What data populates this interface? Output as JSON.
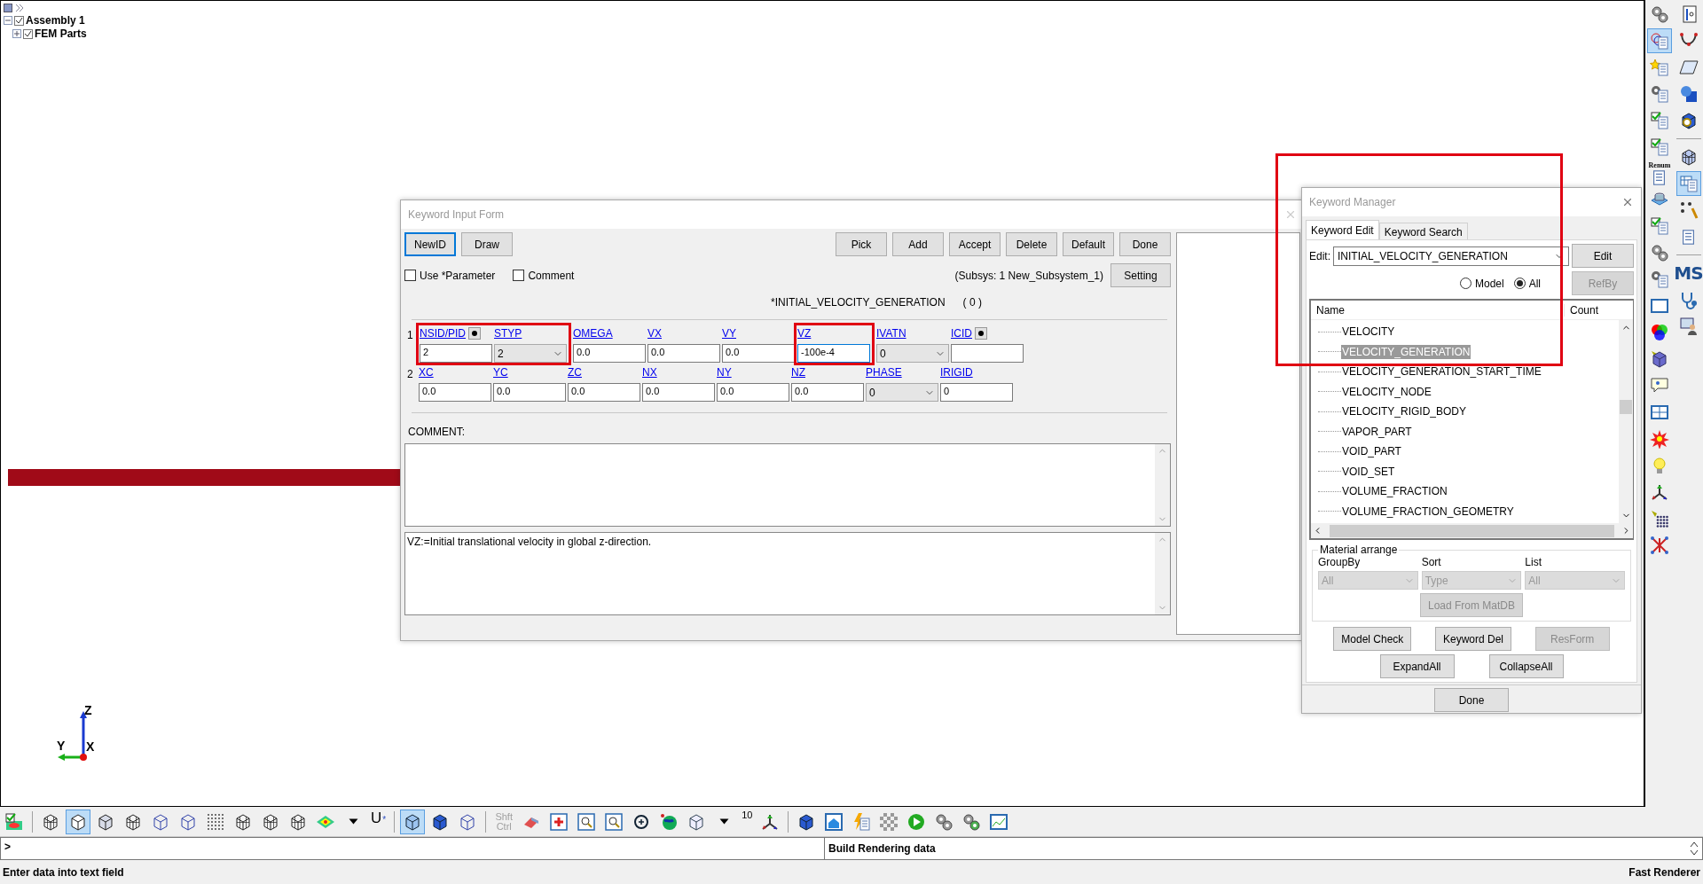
{
  "tree": [
    {
      "label": "Assembly 1",
      "checked": true,
      "expanded": true,
      "children": [
        {
          "label": "FEM Parts",
          "checked": true,
          "expanded": false
        }
      ]
    }
  ],
  "axis": {
    "z": "Z",
    "y": "Y",
    "x": "X"
  },
  "keyword_form": {
    "title": "Keyword Input Form",
    "left_buttons": [
      {
        "label": "NewID",
        "focused": true
      },
      {
        "label": "Draw",
        "focused": false
      }
    ],
    "right_buttons": [
      "Pick",
      "Add",
      "Accept",
      "Delete",
      "Default",
      "Done"
    ],
    "options": [
      {
        "label": "Use *Parameter",
        "checked": false
      },
      {
        "label": "Comment",
        "checked": false
      }
    ],
    "subsys": "(Subsys: 1 New_Subsystem_1)",
    "setting_button": "Setting",
    "keyword": "*INITIAL_VELOCITY_GENERATION",
    "count": "( 0 )",
    "cards": [
      {
        "number": "1",
        "fields": [
          {
            "label": "NSID/PID",
            "kind": "text",
            "value": "2",
            "pick": true,
            "highlighted": true,
            "focused": false
          },
          {
            "label": "STYP",
            "kind": "select",
            "value": "2",
            "highlighted": true,
            "focused": false
          },
          {
            "label": "OMEGA",
            "kind": "text",
            "value": "0.0",
            "focused": false
          },
          {
            "label": "VX",
            "kind": "text",
            "value": "0.0",
            "focused": false
          },
          {
            "label": "VY",
            "kind": "text",
            "value": "0.0",
            "focused": false
          },
          {
            "label": "VZ",
            "kind": "text",
            "value": "-100e-4",
            "highlighted": true,
            "focused": true
          },
          {
            "label": "IVATN",
            "kind": "select",
            "value": "0",
            "focused": false
          },
          {
            "label": "ICID",
            "kind": "text",
            "pick": true,
            "focused": false
          }
        ]
      },
      {
        "number": "2",
        "fields": [
          {
            "label": "XC",
            "kind": "text",
            "value": "0.0",
            "focused": false
          },
          {
            "label": "YC",
            "kind": "text",
            "value": "0.0",
            "focused": false
          },
          {
            "label": "ZC",
            "kind": "text",
            "value": "0.0",
            "focused": false
          },
          {
            "label": "NX",
            "kind": "text",
            "value": "0.0",
            "focused": false
          },
          {
            "label": "NY",
            "kind": "text",
            "value": "0.0",
            "focused": false
          },
          {
            "label": "NZ",
            "kind": "text",
            "value": "0.0",
            "focused": false
          },
          {
            "label": "PHASE",
            "kind": "select",
            "value": "0",
            "focused": false
          },
          {
            "label": "IRIGID",
            "kind": "text",
            "value": "0",
            "focused": false
          }
        ]
      }
    ],
    "comment_label": "COMMENT:",
    "help": "VZ:=Initial translational velocity in global z-direction."
  },
  "keyword_manager": {
    "title": "Keyword Manager",
    "annotation_frame": true,
    "tabs": [
      {
        "label": "Keyword Edit",
        "selected": true
      },
      {
        "label": "Keyword Search",
        "selected": false
      }
    ],
    "edit_label": "Edit:",
    "edit_value": "INITIAL_VELOCITY_GENERATION",
    "edit_button": "Edit",
    "scope": [
      {
        "label": "Model",
        "selected": false
      },
      {
        "label": "All",
        "selected": true
      }
    ],
    "refby_button": {
      "label": "RefBy",
      "disabled": true
    },
    "columns": [
      "Name",
      "Count"
    ],
    "items": [
      {
        "label": "VELOCITY",
        "selected": false
      },
      {
        "label": "VELOCITY_GENERATION",
        "selected": true
      },
      {
        "label": "VELOCITY_GENERATION_START_TIME",
        "selected": false
      },
      {
        "label": "VELOCITY_NODE",
        "selected": false
      },
      {
        "label": "VELOCITY_RIGID_BODY",
        "selected": false
      },
      {
        "label": "VAPOR_PART",
        "selected": false
      },
      {
        "label": "VOID_PART",
        "selected": false
      },
      {
        "label": "VOID_SET",
        "selected": false
      },
      {
        "label": "VOLUME_FRACTION",
        "selected": false
      },
      {
        "label": "VOLUME_FRACTION_GEOMETRY",
        "selected": false
      }
    ],
    "material": {
      "legend": "Material arrange",
      "selects": [
        {
          "label": "GroupBy",
          "value": "All"
        },
        {
          "label": "Sort",
          "value": "Type"
        },
        {
          "label": "List",
          "value": "All"
        }
      ],
      "load_button": "Load From MatDB",
      "disabled": true
    },
    "button_rows": [
      [
        {
          "label": "Model Check",
          "disabled": false
        },
        {
          "label": "Keyword Del",
          "disabled": false
        },
        {
          "label": "ResForm",
          "disabled": true
        }
      ],
      [
        {
          "label": "ExpandAll",
          "disabled": false
        },
        {
          "label": "CollapseAll",
          "disabled": false
        }
      ]
    ],
    "done_button": "Done"
  },
  "right_toolbar": [
    [
      {
        "kind": "gears",
        "selected": false
      },
      {
        "kind": "circles",
        "selected": true
      },
      {
        "kind": "starlist",
        "selected": false
      },
      {
        "kind": "gearlist",
        "selected": false
      },
      {
        "kind": "checklist",
        "selected": false
      },
      {
        "kind": "checklist",
        "selected": false
      },
      {
        "kind": "renum",
        "label": "Renum"
      },
      {
        "kind": "cylinder",
        "selected": false
      },
      {
        "kind": "stacklist",
        "selected": false
      },
      {
        "kind": "gears",
        "selected": false
      },
      {
        "kind": "gearpage",
        "selected": false
      },
      {
        "kind": "window",
        "selected": false
      },
      {
        "kind": "rgb",
        "selected": false
      },
      {
        "kind": "lamp",
        "selected": false
      },
      {
        "kind": "speech",
        "selected": false
      },
      {
        "kind": "grid",
        "selected": false
      },
      {
        "kind": "burst",
        "selected": false
      },
      {
        "kind": "bulb",
        "selected": false
      },
      {
        "kind": "triad",
        "selected": false
      },
      {
        "kind": "lampdots",
        "selected": false
      },
      {
        "kind": "network",
        "selected": false
      }
    ],
    [
      {
        "kind": "axispage",
        "selected": false
      },
      {
        "kind": "curve",
        "selected": false
      },
      {
        "kind": "plane",
        "selected": false
      },
      {
        "kind": "sphere",
        "selected": false
      },
      {
        "kind": "magcube",
        "selected": false
      },
      {
        "kind": "separator"
      },
      {
        "kind": "nodegrid",
        "selected": false
      },
      {
        "kind": "table",
        "selected": true
      },
      {
        "kind": "wrench",
        "selected": false
      },
      {
        "kind": "doclist",
        "selected": false
      },
      {
        "kind": "separator"
      },
      {
        "kind": "label",
        "label": "MS"
      },
      {
        "kind": "stetho",
        "selected": false
      },
      {
        "kind": "person",
        "selected": false
      }
    ]
  ],
  "bottom_toolbar": [
    {
      "kind": "meshcheck",
      "selected": false
    },
    {
      "kind": "separator"
    },
    {
      "kind": "meshcube",
      "selected": false
    },
    {
      "kind": "cube",
      "selected": true
    },
    {
      "kind": "shadecube",
      "selected": false
    },
    {
      "kind": "meshcube",
      "selected": false
    },
    {
      "kind": "wirecube",
      "selected": false
    },
    {
      "kind": "wirecube",
      "selected": false
    },
    {
      "kind": "dotcube",
      "selected": false
    },
    {
      "kind": "meshcube",
      "selected": false
    },
    {
      "kind": "meshcube",
      "selected": false
    },
    {
      "kind": "meshcube",
      "selected": false
    },
    {
      "kind": "colormap",
      "selected": false
    },
    {
      "kind": "caret",
      "selected": false
    },
    {
      "kind": "label",
      "label": "U",
      "sub": "*"
    },
    {
      "kind": "separator"
    },
    {
      "kind": "bluecube",
      "selected": true
    },
    {
      "kind": "solidcube",
      "selected": false
    },
    {
      "kind": "wirecube",
      "selected": false
    },
    {
      "kind": "separator"
    },
    {
      "kind": "label",
      "label": "Shft",
      "sub": "Ctrl",
      "disabled": true
    },
    {
      "kind": "eraser",
      "selected": false
    },
    {
      "kind": "zoomcross",
      "selected": false
    },
    {
      "kind": "zoomin",
      "selected": false
    },
    {
      "kind": "zoomwin",
      "selected": false
    },
    {
      "kind": "rotate",
      "selected": false
    },
    {
      "kind": "globe",
      "selected": false
    },
    {
      "kind": "box",
      "selected": false
    },
    {
      "kind": "caret",
      "selected": false
    },
    {
      "kind": "label",
      "label": "10"
    },
    {
      "kind": "triad",
      "selected": false
    },
    {
      "kind": "separator"
    },
    {
      "kind": "solidcube",
      "selected": false
    },
    {
      "kind": "house",
      "selected": false
    },
    {
      "kind": "bolt",
      "selected": false
    },
    {
      "kind": "checker",
      "selected": false
    },
    {
      "kind": "play",
      "selected": false
    },
    {
      "kind": "gears",
      "selected": false
    },
    {
      "kind": "recycle",
      "selected": false
    },
    {
      "kind": "chartwin",
      "selected": false
    }
  ],
  "command": {
    "prompt": ">",
    "message": "Build Rendering data"
  },
  "status_bar": {
    "message": "Enter data into text field",
    "renderer": "Fast Renderer"
  }
}
